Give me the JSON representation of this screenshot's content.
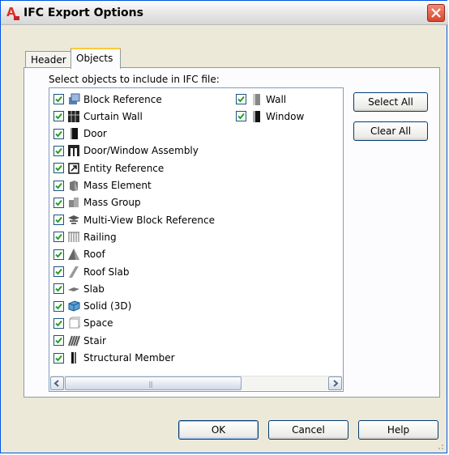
{
  "window": {
    "title": "IFC Export Options"
  },
  "tabs": [
    {
      "label": "Header",
      "active": false
    },
    {
      "label": "Objects",
      "active": true
    }
  ],
  "objects_panel": {
    "instruction": "Select objects to include in IFC file:",
    "items": [
      {
        "label": "Block Reference",
        "checked": true,
        "icon": "block-reference-icon"
      },
      {
        "label": "Curtain Wall",
        "checked": true,
        "icon": "curtain-wall-icon"
      },
      {
        "label": "Door",
        "checked": true,
        "icon": "door-icon"
      },
      {
        "label": "Door/Window Assembly",
        "checked": true,
        "icon": "door-window-assembly-icon"
      },
      {
        "label": "Entity Reference",
        "checked": true,
        "icon": "entity-reference-icon"
      },
      {
        "label": "Mass Element",
        "checked": true,
        "icon": "mass-element-icon"
      },
      {
        "label": "Mass Group",
        "checked": true,
        "icon": "mass-group-icon"
      },
      {
        "label": "Multi-View Block Reference",
        "checked": true,
        "icon": "multi-view-block-icon"
      },
      {
        "label": "Railing",
        "checked": true,
        "icon": "railing-icon"
      },
      {
        "label": "Roof",
        "checked": true,
        "icon": "roof-icon"
      },
      {
        "label": "Roof Slab",
        "checked": true,
        "icon": "roof-slab-icon"
      },
      {
        "label": "Slab",
        "checked": true,
        "icon": "slab-icon"
      },
      {
        "label": "Solid (3D)",
        "checked": true,
        "icon": "solid-3d-icon"
      },
      {
        "label": "Space",
        "checked": true,
        "icon": "space-icon"
      },
      {
        "label": "Stair",
        "checked": true,
        "icon": "stair-icon"
      },
      {
        "label": "Structural Member",
        "checked": true,
        "icon": "structural-member-icon"
      },
      {
        "label": "Wall",
        "checked": true,
        "icon": "wall-icon"
      },
      {
        "label": "Window",
        "checked": true,
        "icon": "window-icon"
      }
    ],
    "select_all_label": "Select All",
    "clear_all_label": "Clear All"
  },
  "footer": {
    "ok_label": "OK",
    "cancel_label": "Cancel",
    "help_label": "Help"
  },
  "colors": {
    "dialog_bg": "#ece9d8",
    "panel_bg": "#fcfcfe",
    "active_tab_accent": "#ffc83c",
    "close_button": "#d9472d",
    "checkmark": "#21a121"
  }
}
